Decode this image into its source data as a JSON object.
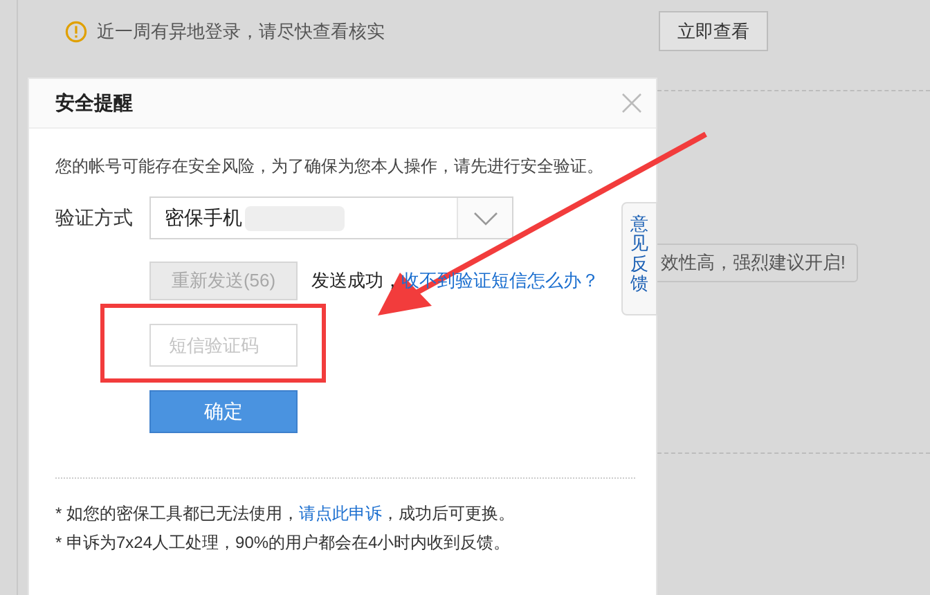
{
  "notice": {
    "text": "近一周有异地登录，请尽快查看核实",
    "button": "立即查看"
  },
  "background_hint": "效性高，强烈建议开启!",
  "feedback_tab": {
    "label": "意见反馈"
  },
  "dialog": {
    "title": "安全提醒",
    "message": "您的帐号可能存在安全风险，为了确保为您本人操作，请先进行安全验证。",
    "method_label": "验证方式",
    "method_value": "密保手机",
    "resend_button": {
      "label": "重新发送(56)",
      "disabled": true
    },
    "send_status": "发送成功，",
    "help_link": "收不到验证短信怎么办？",
    "code_placeholder": "短信验证码",
    "confirm_button": "确定",
    "notes": [
      {
        "parts": [
          {
            "kind": "text",
            "text": "* 如您的密保工具都已无法使用，"
          },
          {
            "kind": "link",
            "text": "请点此申诉"
          },
          {
            "kind": "text",
            "text": "，成功后可更换。"
          }
        ]
      },
      {
        "parts": [
          {
            "kind": "text",
            "text": "* 申诉为7x24人工处理，90%的用户都会在4小时内收到反馈。"
          }
        ]
      }
    ]
  }
}
